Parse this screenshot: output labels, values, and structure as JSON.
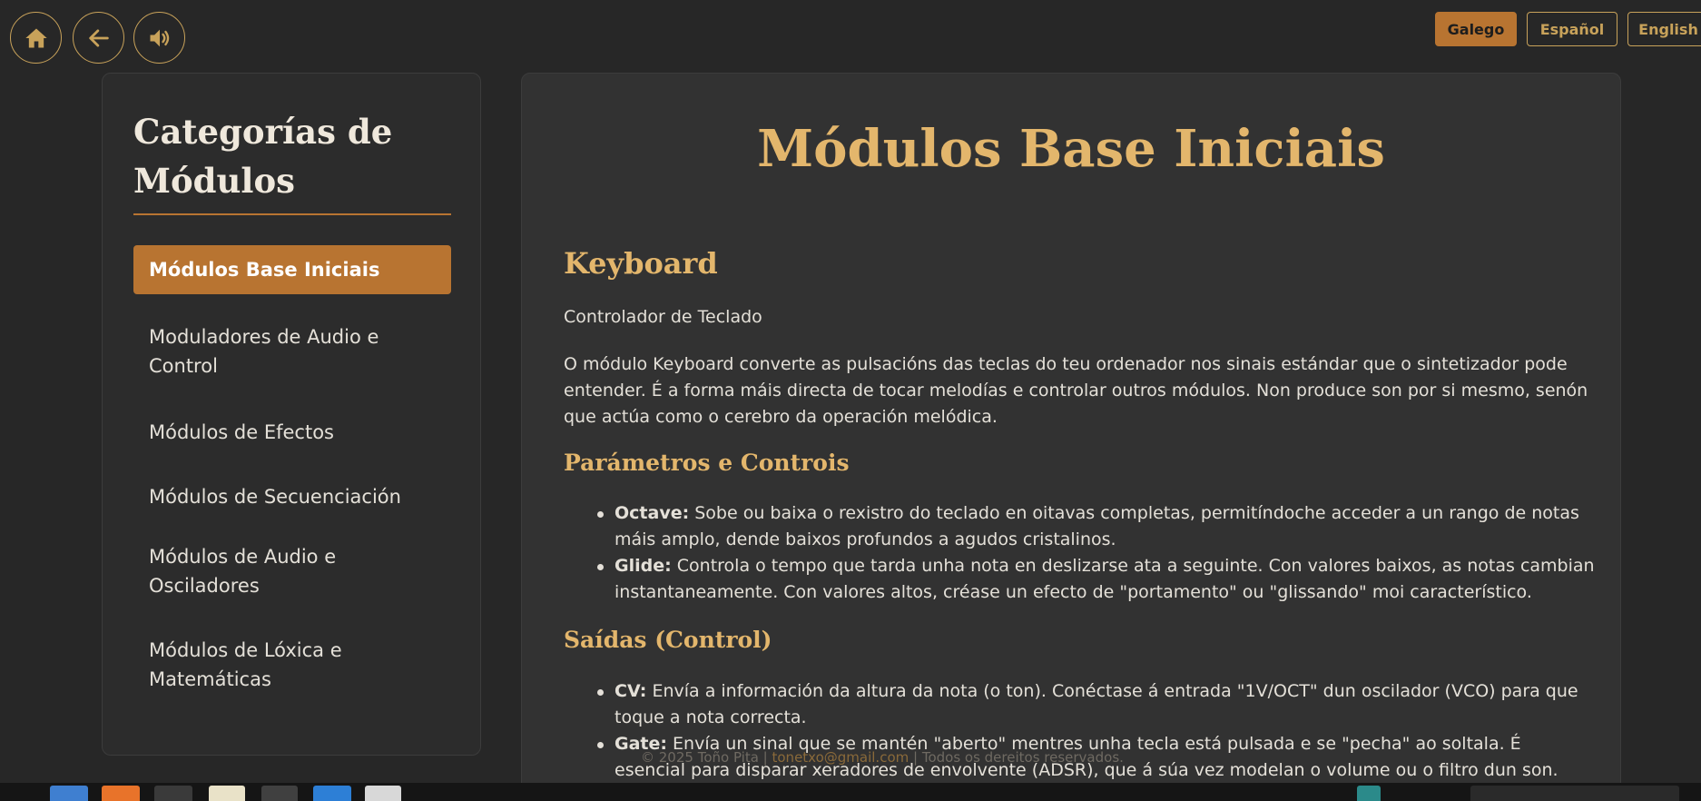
{
  "nav": {
    "home_icon": "home-icon",
    "back_icon": "arrow-left-icon",
    "sound_icon": "speaker-icon"
  },
  "languages": [
    {
      "label": "Galego",
      "active": true
    },
    {
      "label": "Español",
      "active": false
    },
    {
      "label": "English",
      "active": false
    }
  ],
  "sidebar": {
    "title": "Categorías de Módulos",
    "items": [
      {
        "label": "Módulos Base Iniciais",
        "active": true
      },
      {
        "label": "Moduladores de Audio e Control",
        "active": false
      },
      {
        "label": "Módulos de Efectos",
        "active": false
      },
      {
        "label": "Módulos de Secuenciación",
        "active": false
      },
      {
        "label": "Módulos de Audio e Osciladores",
        "active": false
      },
      {
        "label": "Módulos de Lóxica e Matemáticas",
        "active": false
      }
    ]
  },
  "main": {
    "title": "Módulos Base Iniciais",
    "module": {
      "name": "Keyboard",
      "subtitle": "Controlador de Teclado",
      "description": "O módulo Keyboard converte as pulsacións das teclas do teu ordenador nos sinais estándar que o sintetizador pode entender. É a forma máis directa de tocar melodías e controlar outros módulos. Non produce son por si mesmo, senón que actúa como o cerebro da operación melódica.",
      "params_heading": "Parámetros e Controis",
      "params": [
        {
          "name": "Octave:",
          "text": " Sobe ou baixa o rexistro do teclado en oitavas completas, permitíndoche acceder a un rango de notas máis amplo, dende baixos profundos a agudos cristalinos."
        },
        {
          "name": "Glide:",
          "text": " Controla o tempo que tarda unha nota en deslizarse ata a seguinte. Con valores baixos, as notas cambian instantaneamente. Con valores altos, créase un efecto de \"portamento\" ou \"glissando\" moi característico."
        }
      ],
      "outputs_heading": "Saídas (Control)",
      "outputs": [
        {
          "name": "CV:",
          "text": " Envía a información da altura da nota (o ton). Conéctase á entrada \"1V/OCT\" dun oscilador (VCO) para que toque a nota correcta."
        },
        {
          "name": "Gate:",
          "text": " Envía un sinal que se mantén \"aberto\" mentres unha tecla está pulsada e se \"pecha\" ao soltala. É esencial para disparar xeradores de envolvente (ADSR), que á súa vez modelan o volume ou o filtro dun son."
        }
      ]
    }
  },
  "footer": {
    "copyright": "© 2025 Toño Pita | ",
    "email": "tonetxo@gmail.com",
    "rights": " | Todos os dereitos reservados."
  },
  "colors": {
    "accent": "#b87431",
    "heading": "#e3b66c",
    "gold_border": "#c8a25a",
    "background": "#272727"
  }
}
